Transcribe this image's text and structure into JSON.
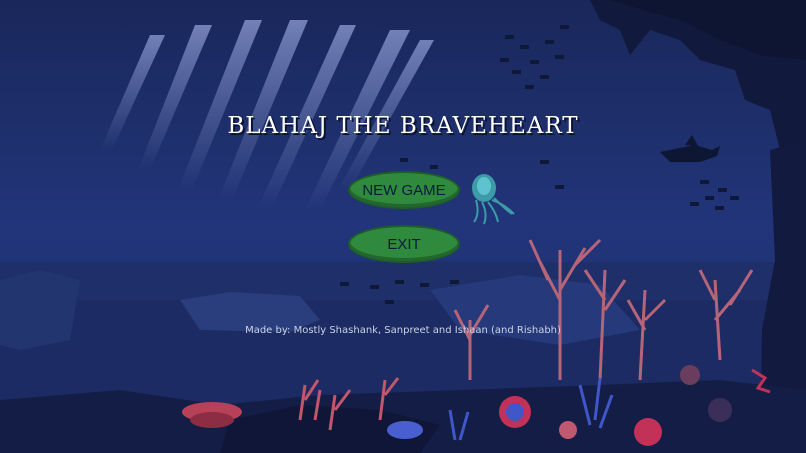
{
  "game": {
    "title": "BLAHAJ THE BRAVEHEART",
    "buttons": {
      "new_game": "NEW GAME",
      "exit": "EXIT"
    },
    "credits": "Made by: Mostly Shashank, Sanpreet and Ishaan (and Rishabh)"
  },
  "colors": {
    "sky_top": "#19275a",
    "sea_mid": "#23347a",
    "sea_floor": "#1a2960",
    "button_fill": "#2f8a3e",
    "button_text": "#0c1a3e",
    "title_text": "#ffffff",
    "jellyfish": "#3d9ba8",
    "coral_pink": "#c0596f",
    "coral_red": "#b8324b",
    "coral_blue": "#3f57c8"
  },
  "icons": [
    "jellyfish-icon",
    "shark-icon",
    "fish-school-icon",
    "coral-icon",
    "rock-icon"
  ]
}
